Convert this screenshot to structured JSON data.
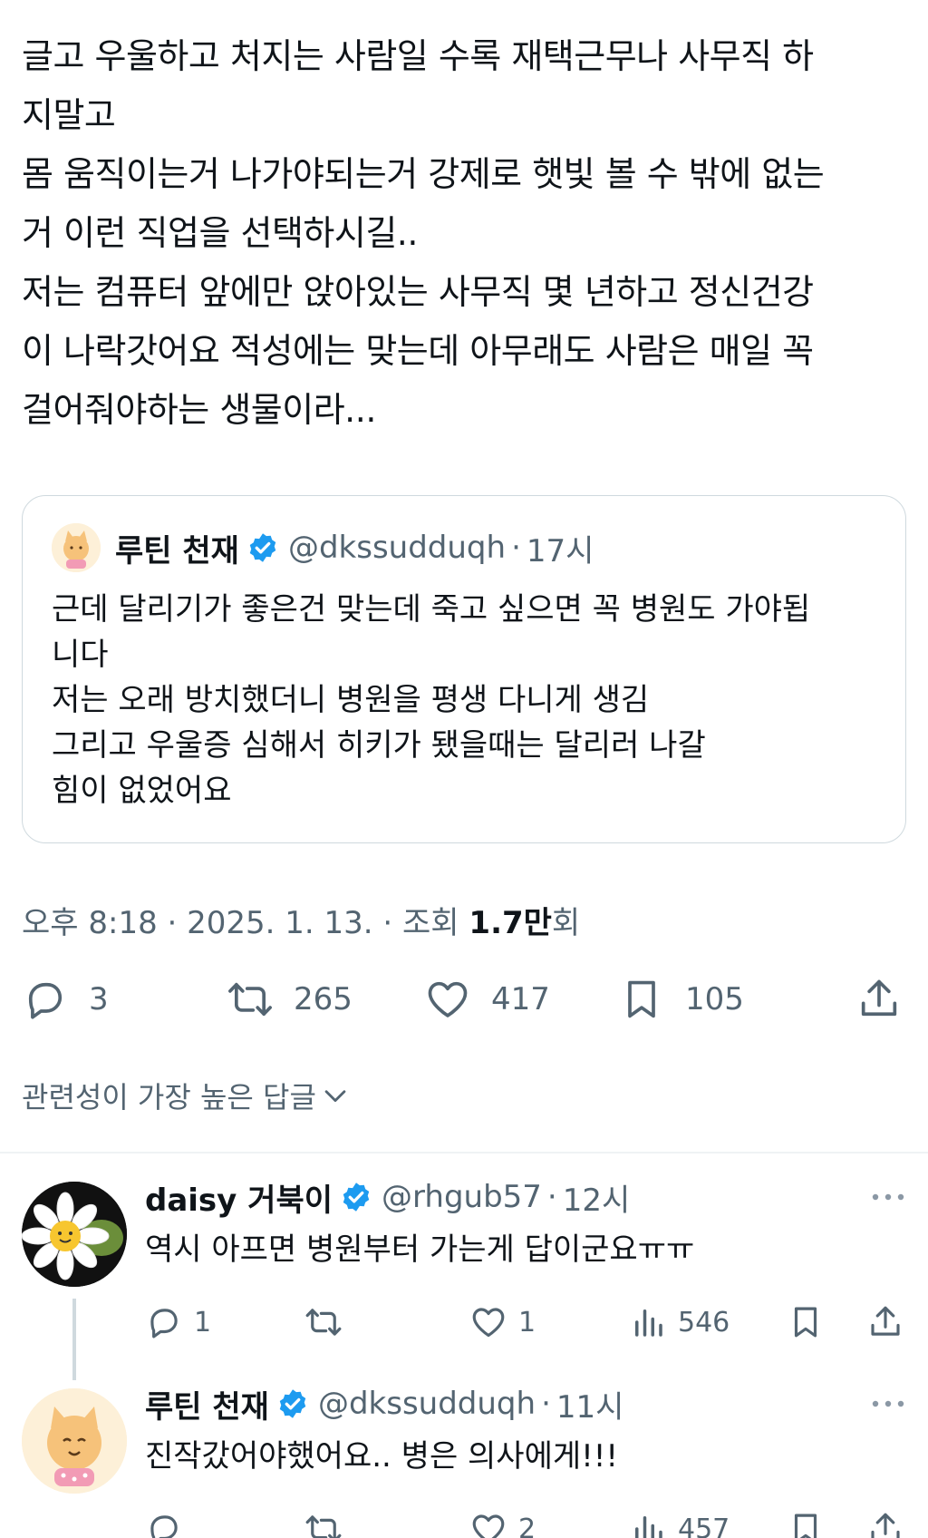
{
  "tweet": {
    "lines": [
      "글고 우울하고 처지는 사람일 수록 재택근무나 사무직 하",
      "지말고",
      "몸 움직이는거 나가야되는거 강제로 햇빛 볼 수 밖에 없는",
      "거 이런 직업을 선택하시길..",
      "저는 컴퓨터 앞에만 앉아있는 사무직 몇 년하고 정신건강",
      "이 나락갓어요 적성에는 맞는데 아무래도 사람은 매일 꼭",
      "걸어줘야하는 생물이라..."
    ],
    "timestamp": "오후 8:18 · 2025. 1. 13. · 조회 ",
    "views_num": "1.7만",
    "views_suffix": "회",
    "stats": {
      "replies": "3",
      "retweets": "265",
      "likes": "417",
      "bookmarks": "105"
    }
  },
  "quote": {
    "name": "루틴 천재",
    "handle": "@dkssudduqh",
    "dot": "·",
    "time": "17시",
    "lines": [
      "근데 달리기가 좋은건 맞는데 죽고 싶으면 꼭 병원도 가야됩",
      "니다",
      "저는 오래 방치했더니 병원을 평생 다니게 생김",
      "그리고 우울증 심해서 히키가 됐을때는 달리러 나갈",
      "힘이 없었어요"
    ]
  },
  "sort_label": "관련성이 가장 높은 답글",
  "replies": [
    {
      "name": "daisy 거북이",
      "handle": "@rhgub57",
      "dot": "·",
      "time": "12시",
      "text": "역시 아프면 병원부터 가는게 답이군요ㅠㅠ",
      "replies": "1",
      "retweets": "",
      "likes": "1",
      "views": "546"
    },
    {
      "name": "루틴 천재",
      "handle": "@dkssudduqh",
      "dot": "·",
      "time": "11시",
      "text": "진작갔어야했어요.. 병은 의사에게!!!",
      "replies": "",
      "retweets": "",
      "likes": "2",
      "views": "457"
    }
  ],
  "colors": {
    "text": "#0f1419",
    "secondary": "#536471",
    "border": "#cfd9de",
    "verified": "#1d9bf0"
  },
  "icons": [
    "reply-icon",
    "retweet-icon",
    "like-icon",
    "bookmark-icon",
    "share-icon",
    "views-icon",
    "more-icon",
    "verified-icon",
    "chevron-down-icon"
  ]
}
